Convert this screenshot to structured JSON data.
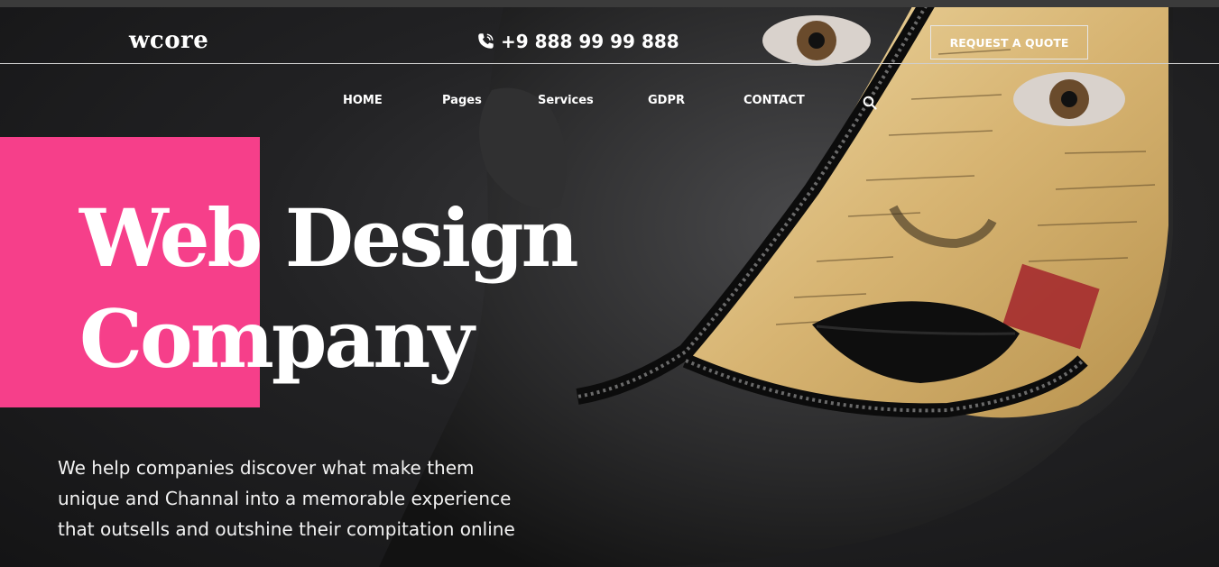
{
  "brand": {
    "logo": "wcore"
  },
  "header": {
    "phone": "+9 888 99 99 888",
    "cta_label": "REQUEST A QUOTE"
  },
  "nav": {
    "items": [
      "HOME",
      "Pages",
      "Services",
      "GDPR",
      "CONTACT"
    ]
  },
  "hero": {
    "headline_line1": "Web Design",
    "headline_line2": "Company",
    "tagline_line1": "We help companies discover what make them",
    "tagline_line2": "unique and Channal into a memorable experience",
    "tagline_line3": "that outsells and outshine their compitation online"
  },
  "icons": {
    "phone": "phone-icon",
    "search": "search-icon"
  },
  "colors": {
    "accent": "#f63f8a",
    "background": "#1b1b1c",
    "text": "#ffffff"
  }
}
